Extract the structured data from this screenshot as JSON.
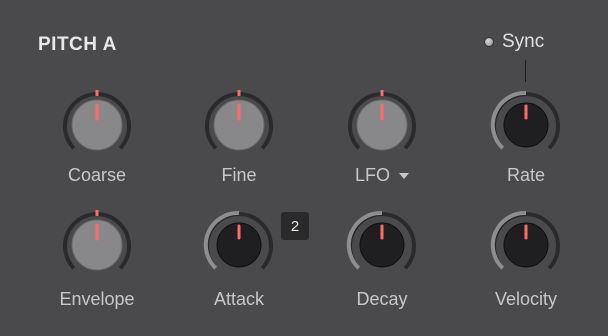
{
  "panel": {
    "title": "PITCH A"
  },
  "sync": {
    "label": "Sync"
  },
  "knobs": {
    "coarse": {
      "label": "Coarse"
    },
    "fine": {
      "label": "Fine"
    },
    "lfo": {
      "label": "LFO",
      "dropdown_icon": "caret-down-icon"
    },
    "rate": {
      "label": "Rate"
    },
    "envelope": {
      "label": "Envelope"
    },
    "attack": {
      "label": "Attack",
      "badge": "2"
    },
    "decay": {
      "label": "Decay"
    },
    "velocity": {
      "label": "Velocity"
    }
  },
  "colors": {
    "background": "#4a4a4c",
    "knob_light": "#8c8c8e",
    "knob_dark": "#202022",
    "indicator": "#ff6b6b",
    "ring_track": "#2a2a2c",
    "ring_value": "#8e8e90",
    "text": "#c8c8c8"
  }
}
